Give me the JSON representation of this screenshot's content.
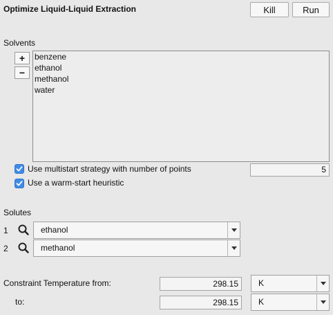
{
  "header": {
    "title": "Optimize Liquid-Liquid Extraction",
    "kill_label": "Kill",
    "run_label": "Run"
  },
  "solvents": {
    "label": "Solvents",
    "add_label": "+",
    "remove_label": "−",
    "items": [
      "benzene",
      "ethanol",
      "methanol",
      "water"
    ]
  },
  "options": {
    "multistart_label": "Use multistart strategy with number of points",
    "multistart_checked": true,
    "multistart_points": "5",
    "warmstart_label": "Use a warm-start heuristic",
    "warmstart_checked": true
  },
  "solutes": {
    "label": "Solutes",
    "rows": [
      {
        "index": "1",
        "value": "ethanol"
      },
      {
        "index": "2",
        "value": "methanol"
      }
    ]
  },
  "constraint": {
    "from_label": "Constraint Temperature from:",
    "to_label": "to:",
    "from_value": "298.15",
    "to_value": "298.15",
    "from_unit": "K",
    "to_unit": "K"
  },
  "colors": {
    "accent": "#3f8be6",
    "background": "#e8e8e8"
  }
}
